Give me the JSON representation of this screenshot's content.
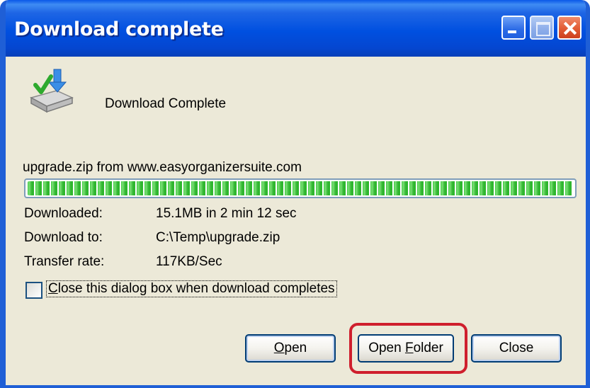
{
  "window": {
    "title": "Download complete"
  },
  "header": {
    "icon": "download-complete-disk-icon",
    "text": "Download Complete"
  },
  "download": {
    "file_line": "upgrade.zip from www.easyorganizersuite.com",
    "progress_fraction": 1.0,
    "rows": [
      {
        "label": "Downloaded:",
        "value": "15.1MB in 2 min 12 sec"
      },
      {
        "label": "Download to:",
        "value": "C:\\Temp\\upgrade.zip"
      },
      {
        "label": "Transfer rate:",
        "value": "117KB/Sec"
      }
    ]
  },
  "checkbox": {
    "label_prefix": "C",
    "label_rest": "lose this dialog box when download completes",
    "checked": false
  },
  "buttons": {
    "open_prefix": "O",
    "open_rest": "pen",
    "folder_prefix": "Open ",
    "folder_mnemonic": "F",
    "folder_rest": "older",
    "close_label": "Close"
  },
  "colors": {
    "titlebar": "#0050e0",
    "progress_fill": "#37c93a",
    "highlight": "#cf1f2d",
    "window_bg": "#ece9d8"
  }
}
